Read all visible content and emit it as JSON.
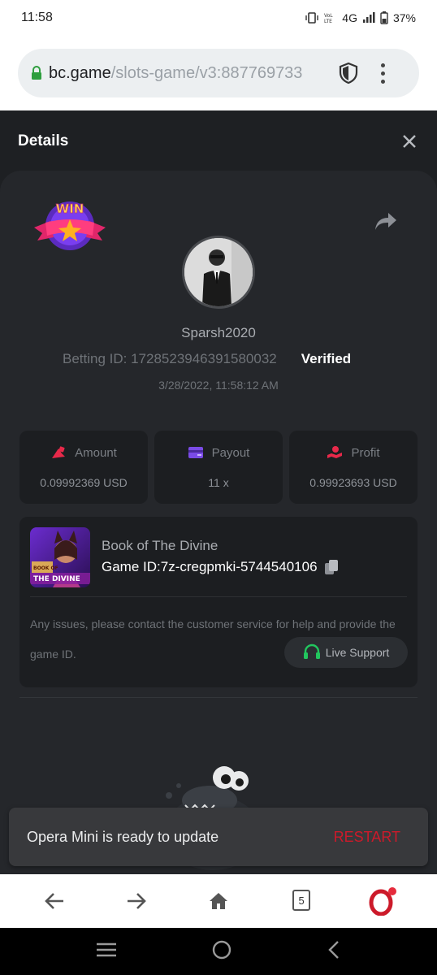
{
  "status_bar": {
    "time": "11:58",
    "network": "4G",
    "battery": "37%"
  },
  "browser": {
    "url_host": "bc.game",
    "url_path": "/slots-game/v3:887769733"
  },
  "details": {
    "title": "Details",
    "win_badge_text": "WIN",
    "username": "Sparsh2020",
    "betting_id": "Betting ID: 1728523946391580032",
    "verified": "Verified",
    "timestamp": "3/28/2022, 11:58:12 AM",
    "stats": [
      {
        "label": "Amount",
        "value": "0.09992369 USD",
        "icon": "amount-icon",
        "color": "#e8294a"
      },
      {
        "label": "Payout",
        "value": "11 x",
        "icon": "payout-icon",
        "color": "#7a4be6"
      },
      {
        "label": "Profit",
        "value": "0.99923693 USD",
        "icon": "profit-icon",
        "color": "#e8294a"
      }
    ],
    "game": {
      "name": "Book of The Divine",
      "game_id": "Game ID:7z-cregpmki-5744540106",
      "thumb_text_top": "BOOK OF",
      "thumb_text_bottom": "THE DIVINE"
    },
    "issue_text": "Any issues, please contact the customer service for help and provide the game ID.",
    "live_support": "Live Support"
  },
  "toast": {
    "message": "Opera Mini is ready to update",
    "action": "RESTART",
    "action_color": "#cc1a2a"
  },
  "bottom_nav": {
    "tab_count": "5"
  },
  "colors": {
    "background": "#1e2023",
    "card": "#25272b",
    "panel": "#1c1e21",
    "accent_green": "#22c55e"
  }
}
